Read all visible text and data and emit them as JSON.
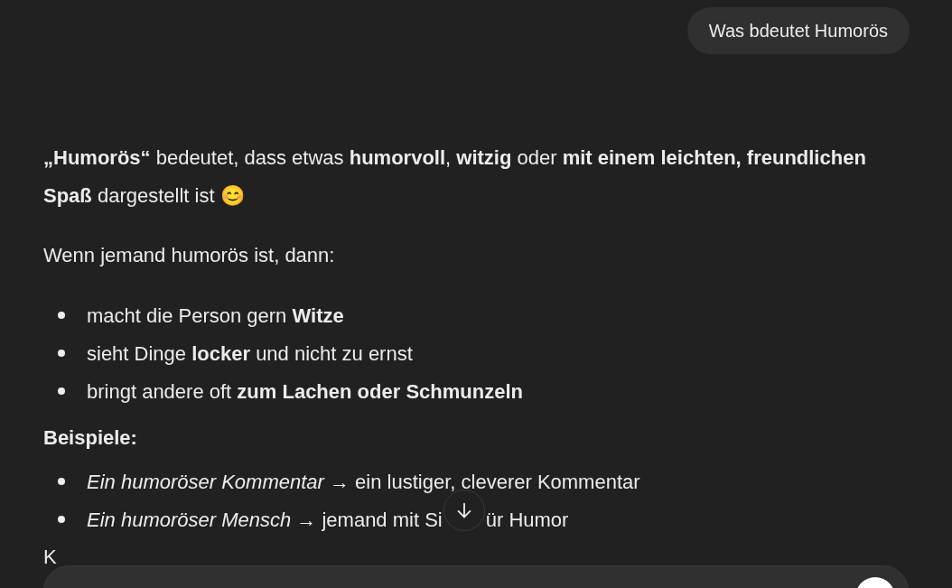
{
  "user_message": "Was bdeutet Humorös",
  "answer": {
    "intro": "**„Humorös“** bedeutet, dass etwas **humorvoll**, **witzig** oder **mit einem leichten, freundlichen Spaß** dargestellt ist 😊",
    "lead": "Wenn jemand humorös ist, dann:",
    "traits": [
      "macht die Person gern **Witze**",
      "sieht Dinge **locker** und nicht zu ernst",
      "bringt andere oft **zum Lachen oder Schmunzeln**"
    ],
    "examples_heading": "Beispiele:",
    "examples": [
      {
        "parts": [
          "*Ein humoröser Kommentar* → ein lustiger, cleverer Kommentar"
        ]
      },
      {
        "parts": [
          "*Ein humoröser Mensch* → jemand mit Si",
          "ür Humor"
        ]
      }
    ],
    "cut_paragraph": "K"
  }
}
